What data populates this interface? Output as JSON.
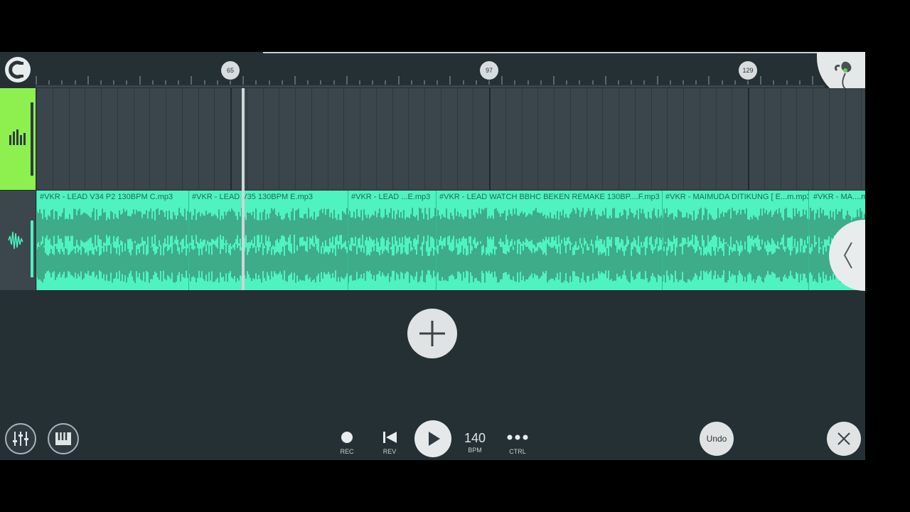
{
  "ruler": {
    "markers": [
      "65",
      "97",
      "129"
    ]
  },
  "tracks": {
    "audio_clips": [
      "#VKR - LEAD V34 P2 130BPM C.mp3",
      "#VKR - LEAD V35 130BPM E.mp3",
      "#VKR - LEAD ...E.mp3",
      "#VKR - LEAD WATCH BBHC BEKEN REMAKE 130BP....F.mp3",
      "#VKR - MAIMUDA DITIKUNG [ E...m.mp3",
      "#VKR - MA....m"
    ]
  },
  "toolbar": {
    "rec_label": "REC",
    "rev_label": "REV",
    "bpm_value": "140",
    "bpm_label": "BPM",
    "ctrl_label": "CTRL",
    "undo_label": "Undo"
  },
  "colors": {
    "background": "#253035",
    "pattern_track": "#8df04e",
    "audio_track": "#4ef3bf",
    "waveform": "#3a9a7a"
  },
  "icons": [
    "magnet-icon",
    "fl-fruit-logo-icon",
    "mixer-icon",
    "audio-wave-icon",
    "plus-icon",
    "mixer-sliders-icon",
    "piano-icon",
    "record-icon",
    "rewind-icon",
    "play-icon",
    "more-icon",
    "close-icon",
    "chevron-left-icon"
  ]
}
